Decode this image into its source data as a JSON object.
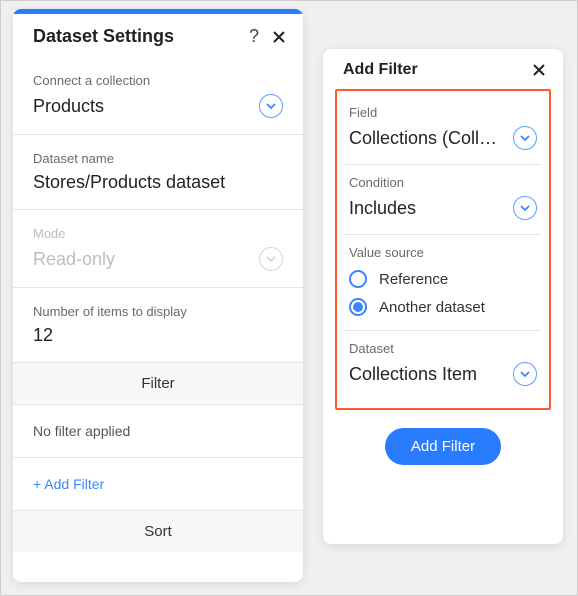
{
  "left": {
    "title": "Dataset Settings",
    "connect_label": "Connect a collection",
    "connect_value": "Products",
    "name_label": "Dataset name",
    "name_value": "Stores/Products dataset",
    "mode_label": "Mode",
    "mode_value": "Read-only",
    "items_label": "Number of items to display",
    "items_value": "12",
    "filter_header": "Filter",
    "no_filter": "No filter applied",
    "add_filter_link": "+ Add Filter",
    "sort_header": "Sort"
  },
  "right": {
    "title": "Add Filter",
    "field_label": "Field",
    "field_value": "Collections (Coll…",
    "condition_label": "Condition",
    "condition_value": "Includes",
    "value_source_label": "Value source",
    "radio_reference": "Reference",
    "radio_another": "Another dataset",
    "dataset_label": "Dataset",
    "dataset_value": "Collections Item",
    "button": "Add Filter"
  }
}
